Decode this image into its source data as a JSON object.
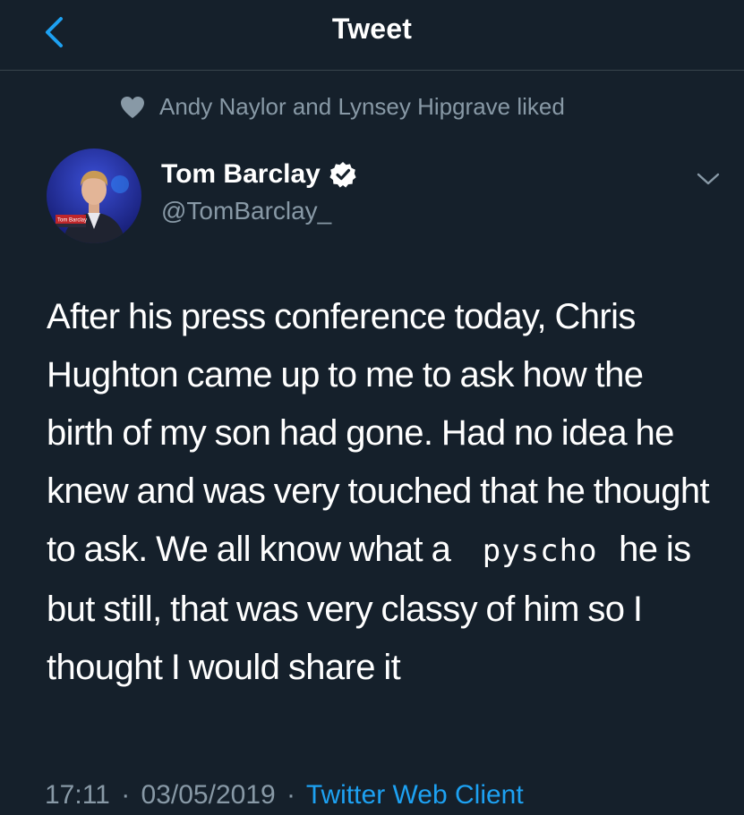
{
  "header": {
    "title": "Tweet",
    "back_icon": "chevron-left-icon"
  },
  "social_context": {
    "text": "Andy Naylor and Lynsey Hipgrave liked",
    "icon": "heart-icon"
  },
  "author": {
    "name": "Tom Barclay",
    "handle": "@TomBarclay_",
    "verified": true,
    "avatar_badge_text": "Tom Barclay"
  },
  "tweet": {
    "text_before": "After his press conference today, Chris Hughton came up to me to ask how the birth of my son had gone. Had no idea he knew and was very touched that he thought to ask. We all know what a ",
    "substituted_word": "pyscho",
    "text_after": " he is but still, that was very classy of him so I thought I would share it"
  },
  "meta": {
    "time": "17:11",
    "date": "03/05/2019",
    "separator": "·",
    "source": "Twitter Web Client"
  },
  "colors": {
    "background": "#15202b",
    "divider": "#38444d",
    "accent": "#1da1f2",
    "secondary_text": "#8899a6",
    "primary_text": "#ffffff"
  }
}
